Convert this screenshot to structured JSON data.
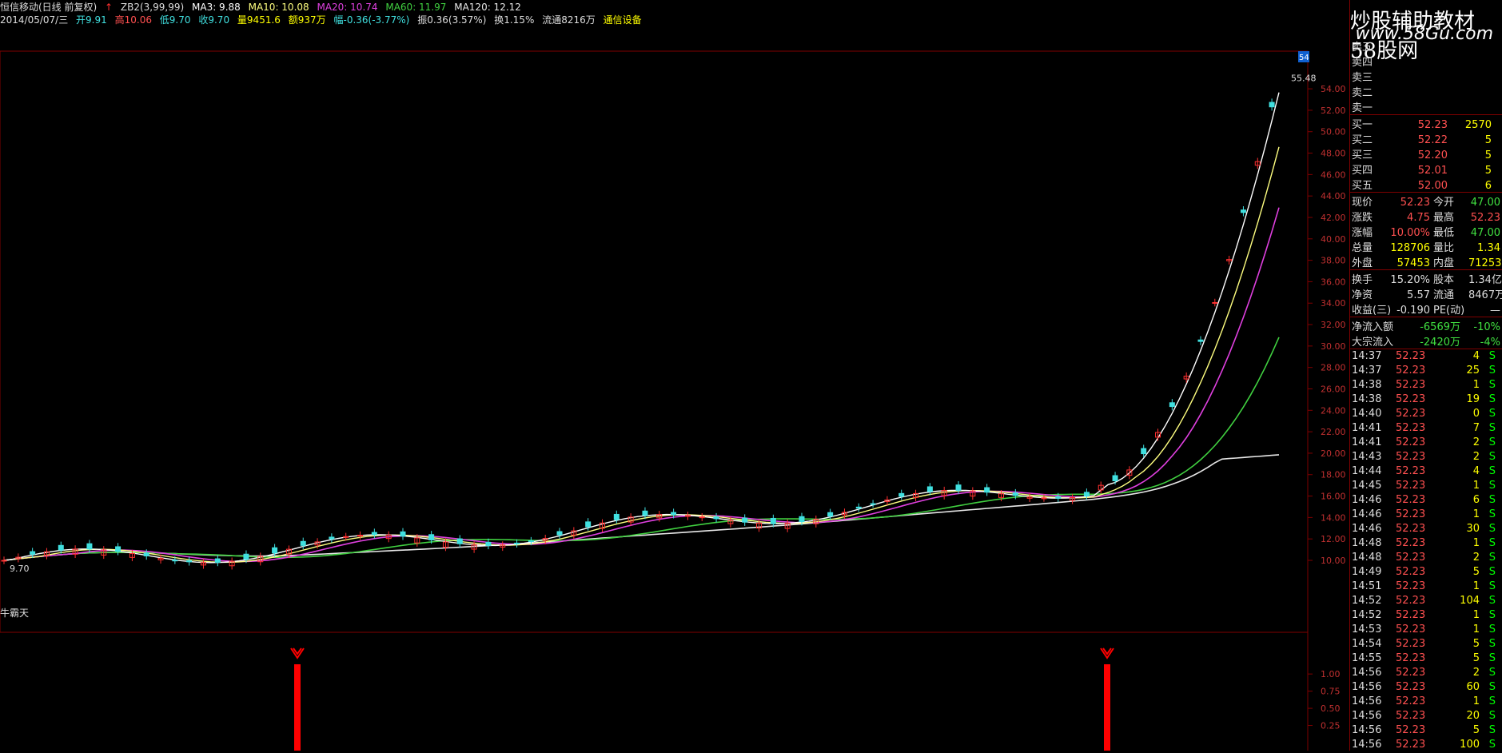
{
  "header": {
    "stock": "恒信移动(日线 前复权)",
    "zb2": "ZB2(3,99,99)",
    "ma3": "MA3: 9.88",
    "ma10": "MA10: 10.08",
    "ma20": "MA20: 10.74",
    "ma60": "MA60: 11.97",
    "ma120": "MA120: 12.12",
    "date": "2014/05/07/三",
    "open": "开9.91",
    "high": "高10.06",
    "low": "低9.70",
    "close": "收9.70",
    "vol": "量9451.6",
    "amount": "额937万",
    "change": "幅-0.36(-3.77%)",
    "amplitude": "振0.36(3.57%)",
    "turnover": "换1.15%",
    "float": "流通8216万",
    "industry": "通信设备"
  },
  "watermark": {
    "title": "炒股辅助教材58股网",
    "url": "www.58Gu.com"
  },
  "chart": {
    "price_axis": [
      "54.00",
      "52.00",
      "50.00",
      "48.00",
      "46.00",
      "44.00",
      "42.00",
      "40.00",
      "38.00",
      "36.00",
      "34.00",
      "32.00",
      "30.00",
      "28.00",
      "26.00",
      "24.00",
      "22.00",
      "20.00",
      "18.00",
      "16.00",
      "14.00",
      "12.00",
      "10.00"
    ],
    "max_label": "55.48",
    "min_label": "9.70",
    "badge": "54",
    "indicator_name": "牛霸天",
    "ind_axis": [
      "1.00",
      "0.75",
      "0.50",
      "0.25"
    ]
  },
  "colors": {
    "ma3": "#ffffff",
    "ma10": "#ffff80",
    "ma20": "#e040e0",
    "ma60": "#40d040",
    "ma120": "#e8e8e8",
    "up": "#ff3030",
    "down": "#40e0e0",
    "signal": "#ff0000"
  },
  "quote": {
    "sell": [
      {
        "label": "卖五"
      },
      {
        "label": "卖四"
      },
      {
        "label": "卖三"
      },
      {
        "label": "卖二"
      },
      {
        "label": "卖一"
      }
    ],
    "buy": [
      {
        "label": "买一",
        "price": "52.23",
        "vol": "2570"
      },
      {
        "label": "买二",
        "price": "52.22",
        "vol": "5"
      },
      {
        "label": "买三",
        "price": "52.20",
        "vol": "5"
      },
      {
        "label": "买四",
        "price": "52.01",
        "vol": "5"
      },
      {
        "label": "买五",
        "price": "52.00",
        "vol": "6"
      }
    ],
    "stats": [
      {
        "l1": "现价",
        "v1": "52.23",
        "l2": "今开",
        "v2": "47.00"
      },
      {
        "l1": "涨跌",
        "v1": "4.75",
        "l2": "最高",
        "v2": "52.23"
      },
      {
        "l1": "涨幅",
        "v1": "10.00%",
        "l2": "最低",
        "v2": "47.00"
      },
      {
        "l1": "总量",
        "v1": "128706",
        "l2": "量比",
        "v2": "1.34"
      },
      {
        "l1": "外盘",
        "v1": "57453",
        "l2": "内盘",
        "v2": "71253"
      }
    ],
    "stats2": [
      {
        "l1": "换手",
        "v1": "15.20%",
        "l2": "股本",
        "v2": "1.34亿"
      },
      {
        "l1": "净资",
        "v1": "5.57",
        "l2": "流通",
        "v2": "8467万"
      },
      {
        "l1": "收益(三)",
        "v1": "-0.190",
        "l2": "PE(动)",
        "v2": "—"
      }
    ],
    "flow": [
      {
        "l": "净流入额",
        "v": "-6569万",
        "p": "-10%"
      },
      {
        "l": "大宗流入",
        "v": "-2420万",
        "p": "-4%"
      }
    ]
  },
  "trades": [
    {
      "t": "14:37",
      "p": "52.23",
      "v": "4",
      "f": "S"
    },
    {
      "t": "14:37",
      "p": "52.23",
      "v": "25",
      "f": "S"
    },
    {
      "t": "14:38",
      "p": "52.23",
      "v": "1",
      "f": "S"
    },
    {
      "t": "14:38",
      "p": "52.23",
      "v": "19",
      "f": "S"
    },
    {
      "t": "14:40",
      "p": "52.23",
      "v": "0",
      "f": "S"
    },
    {
      "t": "14:41",
      "p": "52.23",
      "v": "7",
      "f": "S"
    },
    {
      "t": "14:41",
      "p": "52.23",
      "v": "2",
      "f": "S"
    },
    {
      "t": "14:43",
      "p": "52.23",
      "v": "2",
      "f": "S"
    },
    {
      "t": "14:44",
      "p": "52.23",
      "v": "4",
      "f": "S"
    },
    {
      "t": "14:45",
      "p": "52.23",
      "v": "1",
      "f": "S"
    },
    {
      "t": "14:46",
      "p": "52.23",
      "v": "6",
      "f": "S"
    },
    {
      "t": "14:46",
      "p": "52.23",
      "v": "1",
      "f": "S"
    },
    {
      "t": "14:46",
      "p": "52.23",
      "v": "30",
      "f": "S"
    },
    {
      "t": "14:48",
      "p": "52.23",
      "v": "1",
      "f": "S"
    },
    {
      "t": "14:48",
      "p": "52.23",
      "v": "2",
      "f": "S"
    },
    {
      "t": "14:49",
      "p": "52.23",
      "v": "5",
      "f": "S"
    },
    {
      "t": "14:51",
      "p": "52.23",
      "v": "1",
      "f": "S"
    },
    {
      "t": "14:52",
      "p": "52.23",
      "v": "104",
      "f": "S"
    },
    {
      "t": "14:52",
      "p": "52.23",
      "v": "1",
      "f": "S"
    },
    {
      "t": "14:53",
      "p": "52.23",
      "v": "1",
      "f": "S"
    },
    {
      "t": "14:54",
      "p": "52.23",
      "v": "5",
      "f": "S"
    },
    {
      "t": "14:55",
      "p": "52.23",
      "v": "5",
      "f": "S"
    },
    {
      "t": "14:56",
      "p": "52.23",
      "v": "2",
      "f": "S"
    },
    {
      "t": "14:56",
      "p": "52.23",
      "v": "60",
      "f": "S"
    },
    {
      "t": "14:56",
      "p": "52.23",
      "v": "1",
      "f": "S"
    },
    {
      "t": "14:56",
      "p": "52.23",
      "v": "20",
      "f": "S"
    },
    {
      "t": "14:56",
      "p": "52.23",
      "v": "5",
      "f": "S"
    },
    {
      "t": "14:56",
      "p": "52.23",
      "v": "100",
      "f": "S"
    }
  ]
}
